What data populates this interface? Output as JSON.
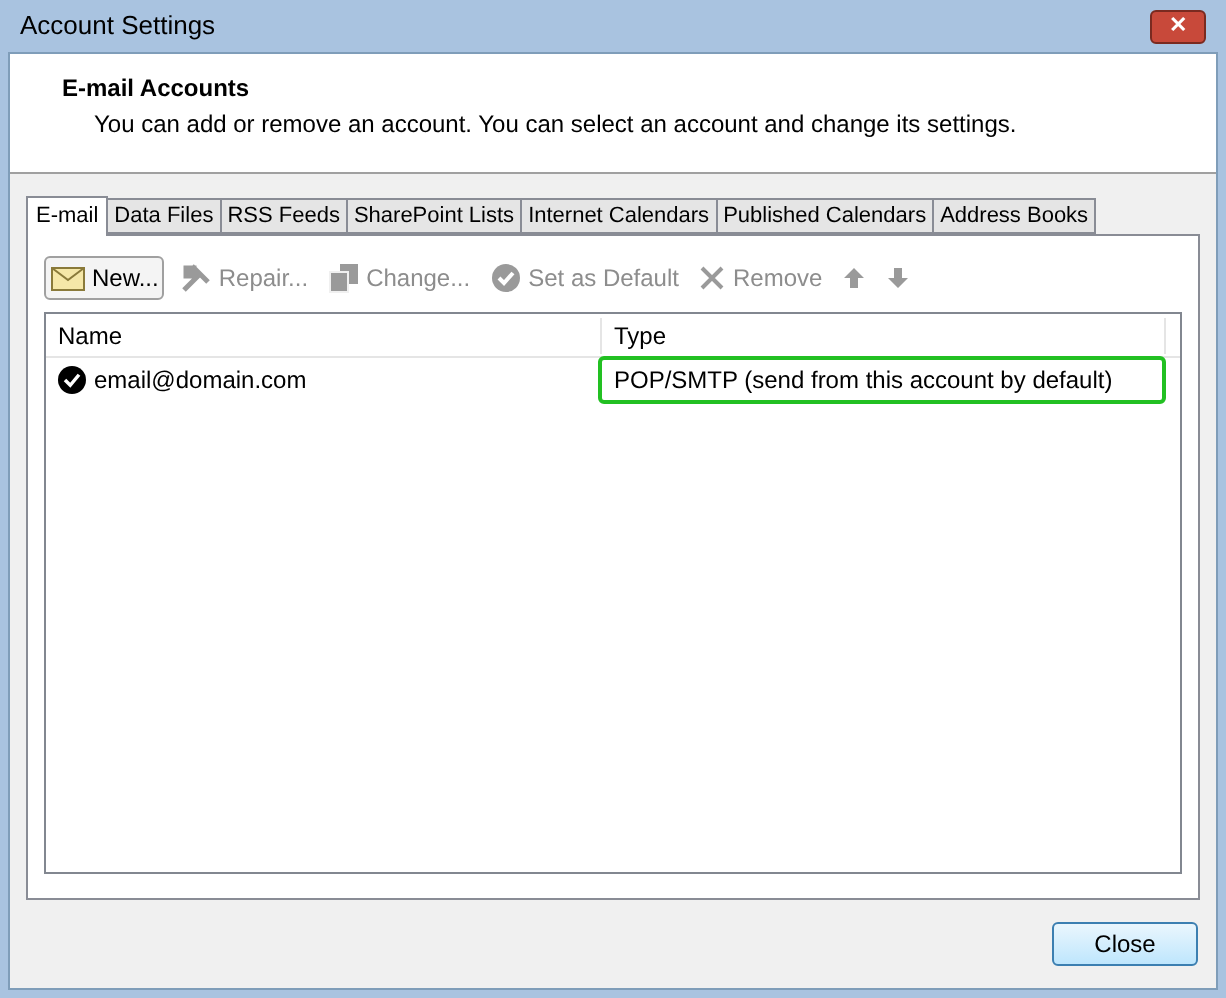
{
  "window": {
    "title": "Account Settings",
    "close": "✕"
  },
  "header": {
    "title": "E-mail Accounts",
    "description": "You can add or remove an account. You can select an account and change its settings."
  },
  "tabs": [
    {
      "label": "E-mail",
      "selected": true
    },
    {
      "label": "Data Files",
      "selected": false
    },
    {
      "label": "RSS Feeds",
      "selected": false
    },
    {
      "label": "SharePoint Lists",
      "selected": false
    },
    {
      "label": "Internet Calendars",
      "selected": false
    },
    {
      "label": "Published Calendars",
      "selected": false
    },
    {
      "label": "Address Books",
      "selected": false
    }
  ],
  "toolbar": [
    {
      "kind": "new",
      "label": "New...",
      "disabled": false
    },
    {
      "kind": "repair",
      "label": "Repair...",
      "disabled": true
    },
    {
      "kind": "change",
      "label": "Change...",
      "disabled": true
    },
    {
      "kind": "default",
      "label": "Set as Default",
      "disabled": true
    },
    {
      "kind": "remove",
      "label": "Remove",
      "disabled": true
    },
    {
      "kind": "up",
      "disabled": true
    },
    {
      "kind": "down",
      "disabled": true
    }
  ],
  "table": {
    "columns": [
      "Name",
      "Type"
    ],
    "rows": [
      {
        "name": "email@domain.com",
        "type": "POP/SMTP (send from this account by default)",
        "default": true,
        "highlighted": true
      }
    ]
  },
  "buttons": [
    {
      "label": "Close"
    }
  ]
}
